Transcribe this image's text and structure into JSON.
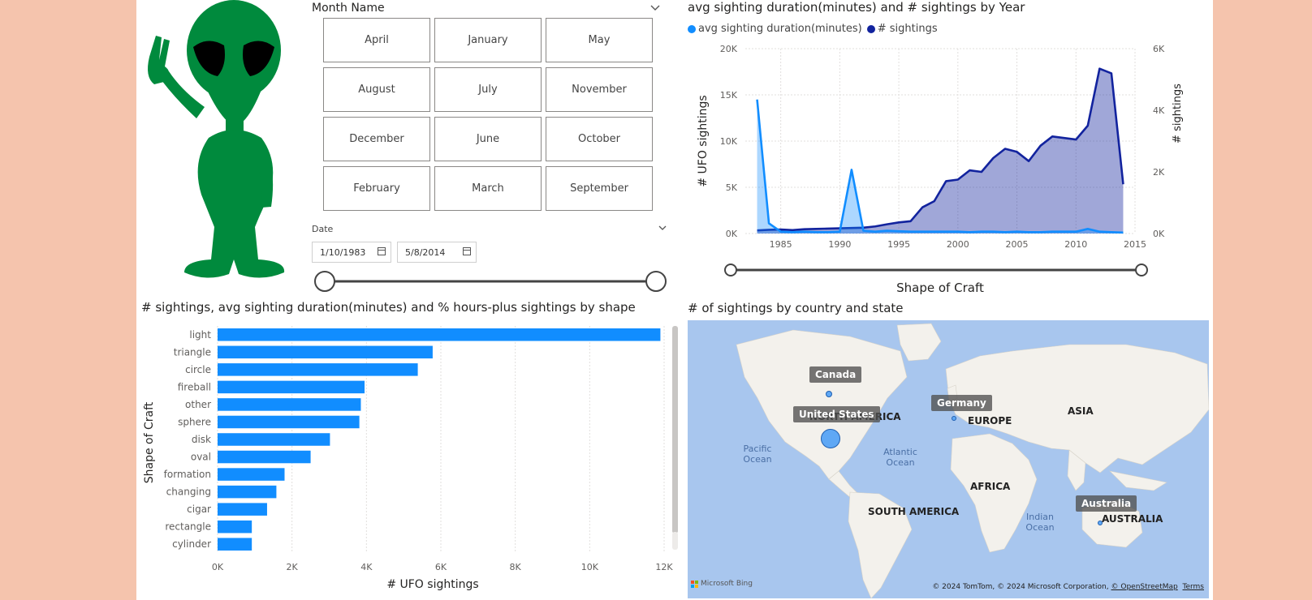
{
  "slicer_month": {
    "title": "Month Name",
    "months": [
      "April",
      "January",
      "May",
      "August",
      "July",
      "November",
      "December",
      "June",
      "October",
      "February",
      "March",
      "September"
    ]
  },
  "slicer_date": {
    "title": "Date",
    "start": "1/10/1983",
    "end": "5/8/2014"
  },
  "map": {
    "title": "# of sightings by country and state",
    "countries": [
      "Canada",
      "United States",
      "Germany",
      "Australia"
    ],
    "continents": [
      "NORTH AMERICA",
      "EUROPE",
      "ASIA",
      "AFRICA",
      "SOUTH AMERICA",
      "AUSTRALIA"
    ],
    "oceans": [
      "Pacific Ocean",
      "Atlantic Ocean",
      "Indian Ocean"
    ],
    "attribution": "© 2024 TomTom, © 2024 Microsoft Corporation,",
    "osm": "© OpenStreetMap",
    "terms": "Terms",
    "brand": "Microsoft Bing"
  },
  "colors": {
    "light_blue": "#118dff",
    "dark_blue": "#12239e",
    "map_water": "#a8c6ee",
    "alien_green": "#008a3d"
  },
  "chart_data": [
    {
      "type": "area",
      "title": "avg sighting duration(minutes) and # sightings by Year",
      "xlabel": "Shape of Craft",
      "ylabel": "# UFO sightings",
      "y2label": "# sightings",
      "xlim": [
        1982,
        2015
      ],
      "ylim": [
        0,
        20000
      ],
      "y2lim": [
        0,
        6000
      ],
      "x_ticks": [
        "1985",
        "1990",
        "1995",
        "2000",
        "2005",
        "2010",
        "2015"
      ],
      "y_ticks": [
        "0K",
        "5K",
        "10K",
        "15K",
        "20K"
      ],
      "y2_ticks": [
        "0K",
        "2K",
        "4K",
        "6K"
      ],
      "legend": [
        "avg sighting duration(minutes)",
        "# sightings"
      ],
      "x": [
        1983,
        1984,
        1985,
        1986,
        1987,
        1988,
        1989,
        1990,
        1991,
        1992,
        1993,
        1994,
        1995,
        1996,
        1997,
        1998,
        1999,
        2000,
        2001,
        2002,
        2003,
        2004,
        2005,
        2006,
        2007,
        2008,
        2009,
        2010,
        2011,
        2012,
        2013,
        2014
      ],
      "series": [
        {
          "name": "avg sighting duration(minutes)",
          "axis": "left",
          "values": [
            14500,
            1100,
            200,
            150,
            200,
            150,
            150,
            200,
            6900,
            300,
            200,
            300,
            250,
            200,
            200,
            200,
            200,
            200,
            150,
            200,
            200,
            150,
            200,
            150,
            150,
            200,
            200,
            200,
            500,
            200,
            150,
            100
          ]
        },
        {
          "name": "# sightings",
          "axis": "right",
          "values": [
            100,
            120,
            130,
            110,
            140,
            150,
            160,
            170,
            180,
            190,
            230,
            300,
            360,
            400,
            850,
            1050,
            1700,
            1750,
            2050,
            2000,
            2450,
            2750,
            2650,
            2350,
            2850,
            3150,
            3100,
            3050,
            3500,
            5350,
            5200,
            1600
          ]
        }
      ]
    },
    {
      "type": "bar",
      "title": "# sightings, avg sighting duration(minutes) and % hours-plus sightings by shape",
      "xlabel": "# UFO sightings",
      "ylabel": "Shape of Craft",
      "xlim": [
        0,
        12000
      ],
      "x_ticks": [
        "0K",
        "2K",
        "4K",
        "6K",
        "8K",
        "10K",
        "12K"
      ],
      "categories": [
        "light",
        "triangle",
        "circle",
        "fireball",
        "other",
        "sphere",
        "disk",
        "oval",
        "formation",
        "changing",
        "cigar",
        "rectangle",
        "cylinder"
      ],
      "values": [
        11900,
        5780,
        5380,
        3950,
        3850,
        3810,
        3020,
        2500,
        1800,
        1580,
        1330,
        920,
        920
      ]
    }
  ]
}
